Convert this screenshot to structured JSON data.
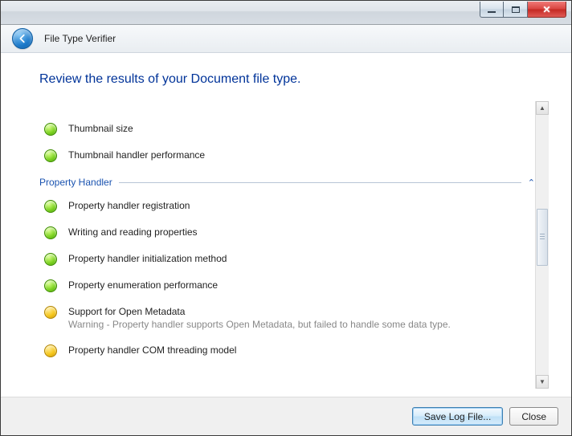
{
  "window": {
    "app_title": "File Type Verifier"
  },
  "heading": "Review the results of your Document file type.",
  "results": {
    "pre_items": [
      {
        "status": "pass",
        "label": "Thumbnail size"
      },
      {
        "status": "pass",
        "label": "Thumbnail handler performance"
      }
    ],
    "section": {
      "title": "Property Handler",
      "expanded": true
    },
    "items": [
      {
        "status": "pass",
        "label": "Property handler registration"
      },
      {
        "status": "pass",
        "label": "Writing and reading properties"
      },
      {
        "status": "pass",
        "label": "Property handler initialization method"
      },
      {
        "status": "pass",
        "label": "Property enumeration performance"
      },
      {
        "status": "warn",
        "label": "Support for Open Metadata",
        "sub": "Warning - Property handler supports Open Metadata, but failed to handle some data type."
      },
      {
        "status": "warn",
        "label": "Property handler COM threading model"
      }
    ]
  },
  "footer": {
    "save_label": "Save Log File...",
    "close_label": "Close"
  }
}
